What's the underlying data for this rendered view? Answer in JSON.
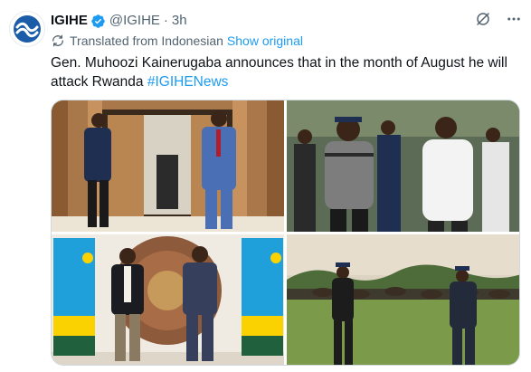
{
  "tweet": {
    "author_name": "IGIHE",
    "handle": "@IGIHE",
    "separator": "·",
    "time": "3h",
    "translated_label": "Translated from Indonesian",
    "show_original": "Show original",
    "text": "Gen. Muhoozi Kainerugaba announces that in the month of August he will attack Rwanda ",
    "hashtag": "#IGIHENews"
  },
  "icons": {
    "avatar": "igihe-logo-icon",
    "verified": "verified-badge-icon",
    "grok": "grok-icon",
    "more": "more-icon",
    "translate": "translate-icon"
  },
  "colors": {
    "link": "#1d9bf0",
    "secondary_text": "#536471",
    "primary_text": "#0f1419"
  }
}
